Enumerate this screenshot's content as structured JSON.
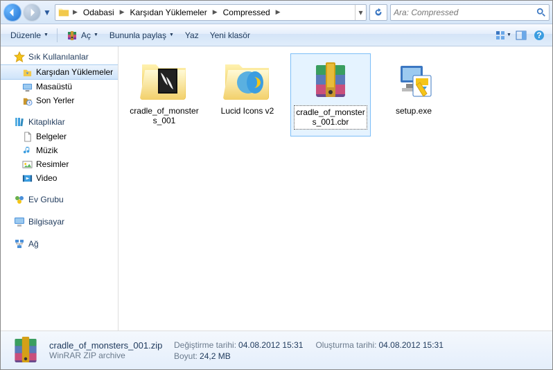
{
  "nav": {
    "breadcrumb": [
      "Odabasi",
      "Karşıdan Yüklemeler",
      "Compressed"
    ],
    "search_placeholder": "Ara: Compressed"
  },
  "toolbar": {
    "organize": "Düzenle",
    "open": "Aç",
    "share": "Bununla paylaş",
    "burn": "Yaz",
    "new_folder": "Yeni klasör"
  },
  "sidebar": {
    "favorites": {
      "label": "Sık Kullanılanlar",
      "items": [
        "Karşıdan Yüklemeler",
        "Masaüstü",
        "Son Yerler"
      ]
    },
    "libraries": {
      "label": "Kitaplıklar",
      "items": [
        "Belgeler",
        "Müzik",
        "Resimler",
        "Video"
      ]
    },
    "homegroup": {
      "label": "Ev Grubu"
    },
    "computer": {
      "label": "Bilgisayar"
    },
    "network": {
      "label": "Ağ"
    }
  },
  "files": [
    {
      "name": "cradle_of_monsters_001",
      "type": "folder-images"
    },
    {
      "name": "Lucid Icons v2",
      "type": "folder-ie"
    },
    {
      "name": "cradle_of_monsters_001.cbr",
      "type": "rar",
      "selected": true,
      "editing": true
    },
    {
      "name": "setup.exe",
      "type": "installer"
    }
  ],
  "details": {
    "filename": "cradle_of_monsters_001.zip",
    "filetype": "WinRAR ZIP archive",
    "modified_label": "Değiştirme tarihi:",
    "modified": "04.08.2012 15:31",
    "size_label": "Boyut:",
    "size": "24,2 MB",
    "created_label": "Oluşturma tarihi:",
    "created": "04.08.2012 15:31"
  }
}
